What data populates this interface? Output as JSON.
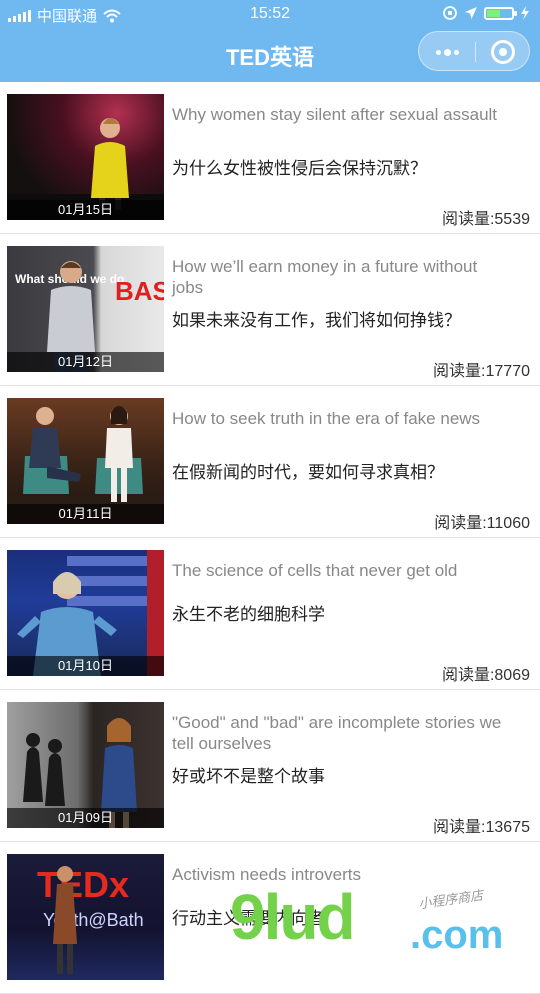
{
  "status_bar": {
    "carrier": "中国联通",
    "time": "15:52",
    "battery_level": 0.55
  },
  "nav": {
    "title": "TED英语"
  },
  "articles": [
    {
      "en": "Why women stay silent after sexual assault",
      "zh": "为什么女性被性侵后会保持沉默？",
      "date": "01月15日",
      "reads": "阅读量:5539"
    },
    {
      "en": "How we’ll earn money in a future without jobs",
      "zh": "如果未来没有工作，我们将如何挣钱？",
      "date": "01月12日",
      "reads": "阅读量:17770"
    },
    {
      "en": "How to seek truth in the era of fake news",
      "zh": "在假新闻的时代，要如何寻求真相？",
      "date": "01月11日",
      "reads": "阅读量:11060"
    },
    {
      "en": "The science of cells that never get old",
      "zh": "永生不老的细胞科学",
      "date": "01月10日",
      "reads": "阅读量:8069"
    },
    {
      "en": "\"Good\" and \"bad\" are incomplete stories we tell ourselves",
      "zh": "好或坏不是整个故事",
      "date": "01月09日",
      "reads": "阅读量:13675"
    },
    {
      "en": "Activism needs introverts",
      "zh": "行动主义需要内向者",
      "date": "",
      "reads": ""
    }
  ],
  "thumb_text": {
    "basic": "BASIC",
    "what_should": "What should we do",
    "tedx": "TEDx",
    "tedx_sub": "Youth@Bath"
  },
  "watermark": {
    "main": "9lud",
    "com": ".com",
    "hand": "小程序商店"
  }
}
